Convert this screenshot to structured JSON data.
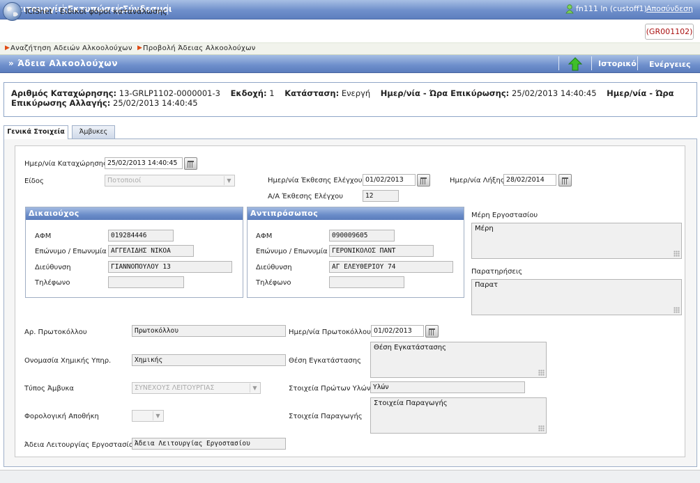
{
  "menu": {
    "items": [
      "Λειτουργίες",
      "Εκτυπώσεις",
      "Σύνδεσμοι"
    ],
    "user": "fn111 ln (custoff1)",
    "logout": "Αποσύνδεση"
  },
  "app": {
    "title": "ICISnet : Ειδικοί φόροι κατανάλωσης",
    "code": "(GR001102)"
  },
  "breadcrumb": [
    "Αναζήτηση Αδειών Αλκοολούχων",
    "Προβολή Άδειας Αλκοολούχων"
  ],
  "section": {
    "title": "» Άδεια Αλκοολούχων",
    "history": "Ιστορικό",
    "actions": "Ενέργειες",
    "up_icon": "up-arrow-icon"
  },
  "info": {
    "reg_label": "Αριθμός Καταχώρησης:",
    "reg_value": "13-GRLP1102-0000001-3",
    "version_label": "Εκδοχή:",
    "version_value": "1",
    "status_label": "Κατάσταση:",
    "status_value": "Ενεργή",
    "validation_label": "Ημερ/νία - Ώρα Επικύρωσης:",
    "validation_value": "25/02/2013 14:40:45",
    "change_label": "Ημερ/νία - Ώρα Επικύρωσης Αλλαγής:",
    "change_value": "25/02/2013 14:40:45"
  },
  "tabs": [
    "Γενικά Στοιχεία",
    "Άμβυκες"
  ],
  "form": {
    "reg_date_label": "Ημερ/νία Καταχώρησης",
    "reg_date": "25/02/2013 14:40:45",
    "kind_label": "Είδος",
    "kind_value": "Ποτοποιοί",
    "inspection_date_label": "Ημερ/νία Έκθεσης Ελέγχου",
    "inspection_date": "01/02/2013",
    "expiry_label": "Ημερ/νία Λήξης",
    "expiry_date": "28/02/2014",
    "inspection_no_label": "Α/Α Έκθεσης Ελέγχου",
    "inspection_no": "12",
    "holder": {
      "title": "Δικαιούχος",
      "afm_label": "ΑΦΜ",
      "afm": "019284446",
      "name_label": "Επώνυμο / Επωνυμία",
      "name": "ΑΓΓΕΛΙΔΗΣ ΝΙΚΟΑ",
      "address_label": "Διεύθυνση",
      "address": "ΓΙΑΝΝΟΠΟΥΛΟΥ 13",
      "phone_label": "Τηλέφωνο",
      "phone": ""
    },
    "rep": {
      "title": "Αντιπρόσωπος",
      "afm_label": "ΑΦΜ",
      "afm": "090009605",
      "name_label": "Επώνυμο / Επωνυμία",
      "name": "ΓΕΡΟΝΙΚΟΛΟΣ ΠΑΝΤ",
      "address_label": "Διεύθυνση",
      "address": "ΑΓ ΕΛΕΥΘΕΡΙΟΥ 74",
      "phone_label": "Τηλέφωνο",
      "phone": ""
    },
    "factory_parts_label": "Μέρη Εργοστασίου",
    "factory_parts": "Μέρη",
    "remarks_label": "Παρατηρήσεις",
    "remarks": "Παρατ",
    "protocol_no_label": "Αρ. Πρωτοκόλλου",
    "protocol_no": "Πρωτοκόλλου",
    "protocol_date_label": "Ημερ/νία Πρωτοκόλλου",
    "protocol_date": "01/02/2013",
    "chem_label": "Ονομασία Χημικής Υπηρ.",
    "chem": "Χημικής",
    "location_label": "Θέση Εγκατάστασης",
    "location": "Θέση Εγκατάστασης",
    "still_type_label": "Τύπος Άμβυκα",
    "still_type": "ΣΥΝΕΧΟΥΣ ΛΕΙΤΟΥΡΓΙΑΣ",
    "raw_label": "Στοιχεία Πρώτων Υλών",
    "raw": "Υλών",
    "tax_label": "Φορολογική Αποθήκη",
    "tax": "",
    "prod_label": "Στοιχεία Παραγωγής",
    "prod": "Στοιχεία Παραγωγής",
    "license_label": "Άδεια Λειτουργίας Εργοστασίου",
    "license": "Άδεια Λειτουργίας Εργοστασίου"
  }
}
